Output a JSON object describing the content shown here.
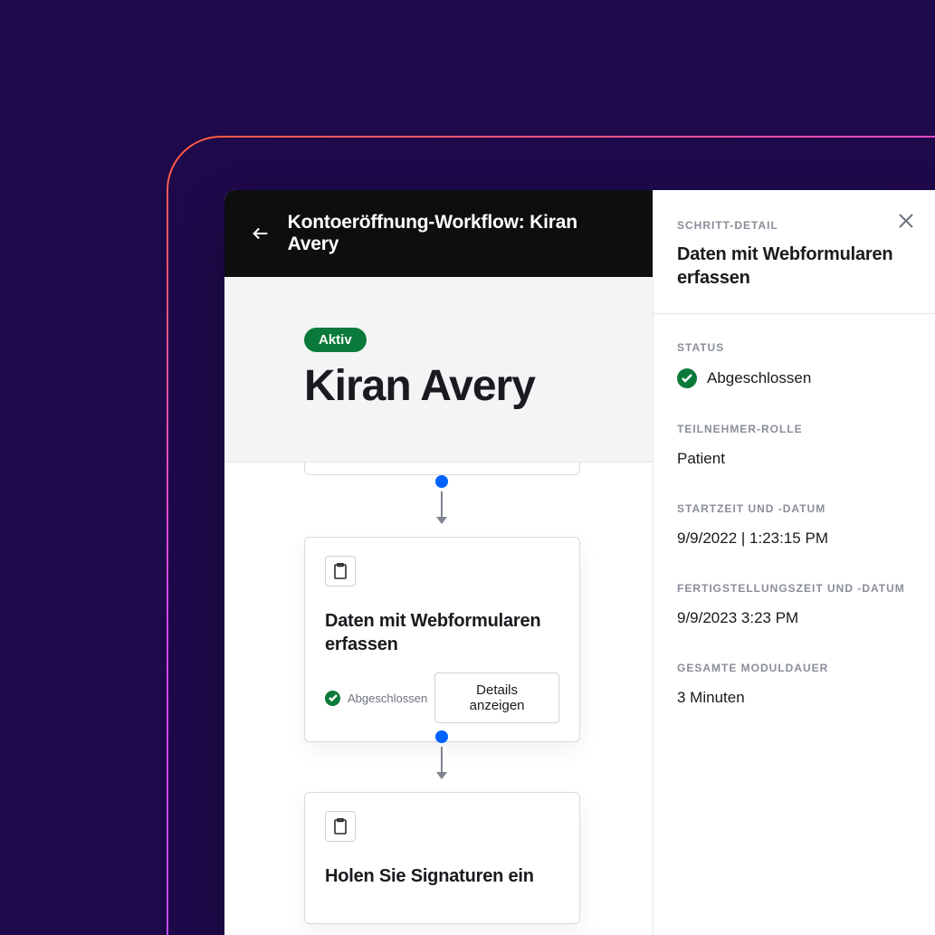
{
  "header": {
    "title": "Kontoeröffnung-Workflow: Kiran Avery"
  },
  "subheader": {
    "status_pill": "Aktiv",
    "person_name": "Kiran Avery"
  },
  "workflow": {
    "card1": {
      "title": "Daten mit Webformularen erfassen",
      "status_text": "Abgeschlossen",
      "button_label": "Details anzeigen"
    },
    "card2": {
      "title": "Holen Sie Signaturen ein"
    }
  },
  "detail": {
    "header_label": "SCHRITT-DETAIL",
    "title": "Daten mit Webformularen erfassen",
    "status": {
      "label": "STATUS",
      "value": "Abgeschlossen"
    },
    "role": {
      "label": "TEILNEHMER-ROLLE",
      "value": "Patient"
    },
    "start": {
      "label": "STARTZEIT UND -DATUM",
      "value": "9/9/2022 | 1:23:15 PM"
    },
    "end": {
      "label": "FERTIGSTELLUNGSZEIT UND -DATUM",
      "value": "9/9/2023 3:23 PM"
    },
    "duration": {
      "label": "GESAMTE MODULDAUER",
      "value": "3 Minuten"
    }
  },
  "colors": {
    "accent_green": "#0a7a3a",
    "accent_blue": "#0062ff",
    "background_dark": "#1e0a4a"
  }
}
